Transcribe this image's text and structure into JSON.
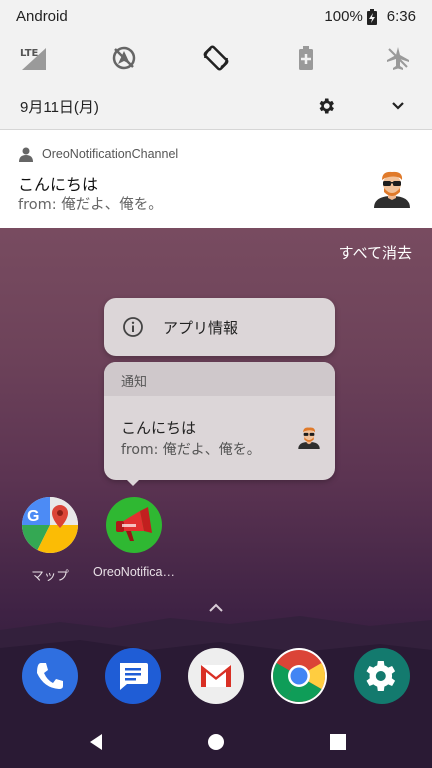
{
  "status_bar": {
    "carrier": "Android",
    "battery_percent": "100%",
    "time": "6:36"
  },
  "quick_settings": {
    "tiles": [
      {
        "name": "lte-signal",
        "label": "LTE"
      },
      {
        "name": "location-off"
      },
      {
        "name": "auto-rotate"
      },
      {
        "name": "battery-saver"
      },
      {
        "name": "airplane-mode"
      }
    ]
  },
  "shade": {
    "date": "9月11日(月)"
  },
  "notification": {
    "app_name": "OreoNotificationChannel",
    "title": "こんにちは",
    "body": "from: 俺だよ、俺を。"
  },
  "clear_all_label": "すべて消去",
  "shortcut_popup": {
    "app_info_label": "アプリ情報",
    "notifications_header": "通知",
    "notification_title": "こんにちは",
    "notification_body": "from: 俺だよ、俺を。"
  },
  "home_apps": [
    {
      "name": "maps",
      "label": "マップ"
    },
    {
      "name": "oreo-notification",
      "label": "OreoNotifica…"
    }
  ],
  "dock_apps": [
    "phone",
    "messages",
    "gmail",
    "chrome",
    "settings"
  ],
  "colors": {
    "shade_bg": "#f2f2f2",
    "popup_bg": "#dcd6d8",
    "wallpaper_top": "#7b4e62",
    "wallpaper_bottom": "#1f1531"
  }
}
